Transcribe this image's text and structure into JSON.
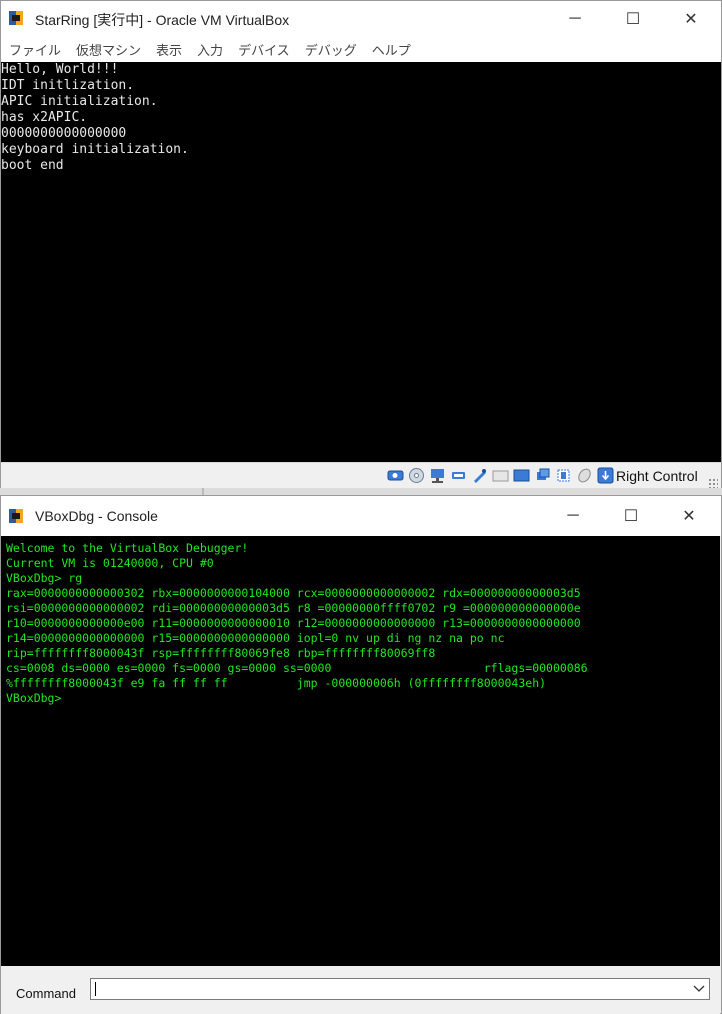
{
  "vbox_window": {
    "title": "StarRing [実行中] - Oracle VM VirtualBox",
    "controls": {
      "minimize": "─",
      "maximize": "☐",
      "close": "✕"
    },
    "menu": [
      "ファイル",
      "仮想マシン",
      "表示",
      "入力",
      "デバイス",
      "デバッグ",
      "ヘルプ"
    ],
    "screen_lines": [
      "Hello, World!!!",
      "IDT initlization.",
      "APIC initialization.",
      "has x2APIC.",
      "0000000000000000",
      "keyboard initialization.",
      "boot end"
    ],
    "status": {
      "host_key": "Right Control"
    },
    "status_icons": [
      "hard-disk-icon",
      "optical-drive-icon",
      "network-icon",
      "usb-icon",
      "shared-folder-icon",
      "display-icon",
      "video-capture-icon",
      "recording-icon",
      "cpu-icon",
      "mouse-integration-icon",
      "keyboard-icon"
    ]
  },
  "dbg_window": {
    "title": "VBoxDbg - Console",
    "controls": {
      "minimize": "─",
      "maximize": "☐",
      "close": "✕"
    },
    "console_lines": [
      "Welcome to the VirtualBox Debugger!",
      "Current VM is 01240000, CPU #0",
      "VBoxDbg> rg",
      "rax=0000000000000302 rbx=0000000000104000 rcx=0000000000000002 rdx=00000000000003d5",
      "rsi=0000000000000002 rdi=00000000000003d5 r8 =00000000ffff0702 r9 =000000000000000e",
      "r10=0000000000000e00 r11=0000000000000010 r12=0000000000000000 r13=0000000000000000",
      "r14=0000000000000000 r15=0000000000000000 iopl=0 nv up di ng nz na po nc",
      "rip=ffffffff8000043f rsp=ffffffff80069fe8 rbp=ffffffff80069ff8",
      "cs=0008 ds=0000 es=0000 fs=0000 gs=0000 ss=0000                      rflags=00000086",
      "%ffffffff8000043f e9 fa ff ff ff          jmp -000000006h (0ffffffff8000043eh)",
      "VBoxDbg>"
    ],
    "command_label": "Command",
    "command_value": ""
  },
  "colors": {
    "console_green": "#22e622",
    "vm_text": "#e8e8e8",
    "background": "#000000"
  }
}
